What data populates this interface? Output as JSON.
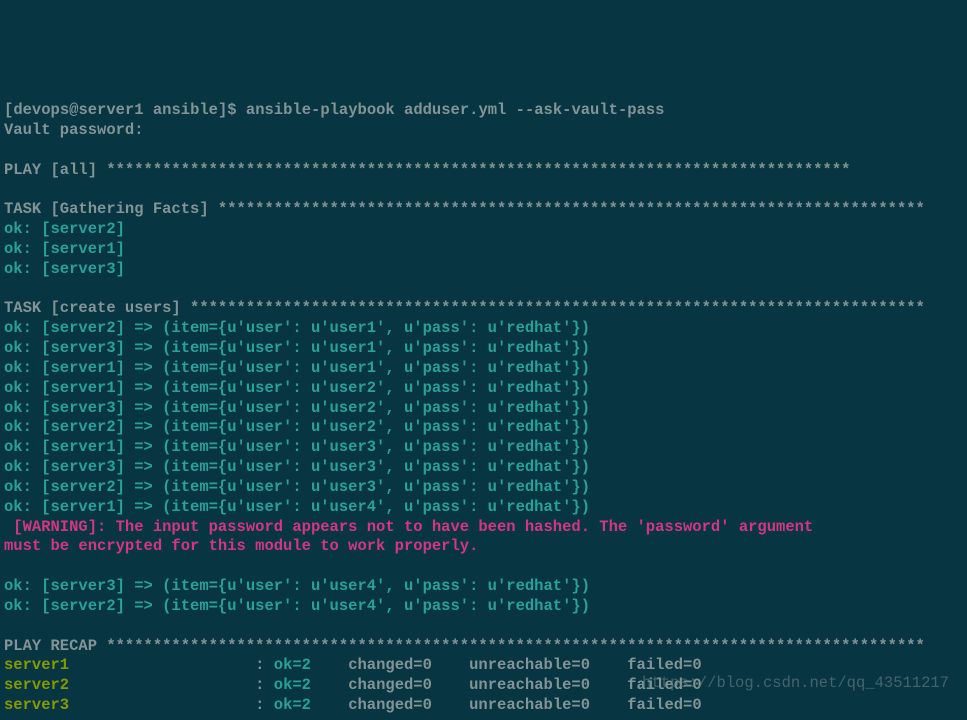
{
  "prompt": {
    "user": "devops",
    "host": "server1",
    "dir": "ansible",
    "command": "ansible-playbook adduser.yml --ask-vault-pass"
  },
  "vault_prompt": "Vault password:",
  "play_header": "PLAY [all]",
  "task_facts_header": "TASK [Gathering Facts]",
  "facts_ok": [
    "server2",
    "server1",
    "server3"
  ],
  "task_create_header": "TASK [create users]",
  "create_items_pre": [
    {
      "server": "server2",
      "user": "user1",
      "pass": "redhat"
    },
    {
      "server": "server3",
      "user": "user1",
      "pass": "redhat"
    },
    {
      "server": "server1",
      "user": "user1",
      "pass": "redhat"
    },
    {
      "server": "server1",
      "user": "user2",
      "pass": "redhat"
    },
    {
      "server": "server3",
      "user": "user2",
      "pass": "redhat"
    },
    {
      "server": "server2",
      "user": "user2",
      "pass": "redhat"
    },
    {
      "server": "server1",
      "user": "user3",
      "pass": "redhat"
    },
    {
      "server": "server3",
      "user": "user3",
      "pass": "redhat"
    },
    {
      "server": "server2",
      "user": "user3",
      "pass": "redhat"
    },
    {
      "server": "server1",
      "user": "user4",
      "pass": "redhat"
    }
  ],
  "warning": " [WARNING]: The input password appears not to have been hashed. The 'password' argument\nmust be encrypted for this module to work properly.",
  "create_items_post": [
    {
      "server": "server3",
      "user": "user4",
      "pass": "redhat"
    },
    {
      "server": "server2",
      "user": "user4",
      "pass": "redhat"
    }
  ],
  "recap_header": "PLAY RECAP",
  "recap": [
    {
      "server": "server1",
      "ok": 2,
      "changed": 0,
      "unreachable": 0,
      "failed": 0
    },
    {
      "server": "server2",
      "ok": 2,
      "changed": 0,
      "unreachable": 0,
      "failed": 0
    },
    {
      "server": "server3",
      "ok": 2,
      "changed": 0,
      "unreachable": 0,
      "failed": 0
    }
  ],
  "watermark": "https://blog.csdn.net/qq_43511217"
}
